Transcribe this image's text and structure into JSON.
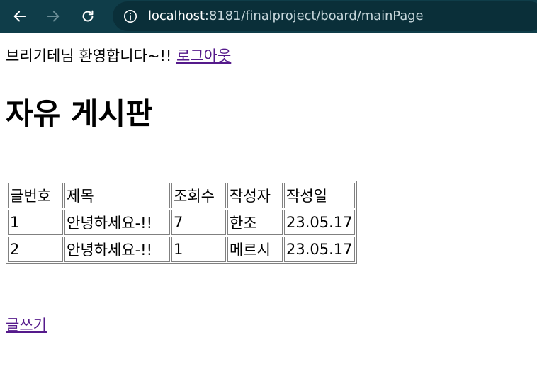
{
  "browser": {
    "url_host": "localhost",
    "url_path": ":8181/finalproject/board/mainPage",
    "icons": [
      "back-arrow-icon",
      "forward-arrow-icon",
      "reload-icon",
      "info-icon"
    ]
  },
  "header": {
    "welcome_text": "브리기테님 환영합니다~!!",
    "logout_label": "로그아웃"
  },
  "title": "자유 게시판",
  "table": {
    "headers": [
      "글번호",
      "제목",
      "조회수",
      "작성자",
      "작성일"
    ],
    "rows": [
      [
        "1",
        "안녕하세요-!!",
        "7",
        "한조",
        "23.05.17"
      ],
      [
        "2",
        "안녕하세요-!!",
        "1",
        "메르시",
        "23.05.17"
      ]
    ]
  },
  "write_label": "글쓰기",
  "colors": {
    "browser_bar": "#0f3d49",
    "url_pill": "#0a2f39",
    "visited_link": "#551a8b"
  }
}
